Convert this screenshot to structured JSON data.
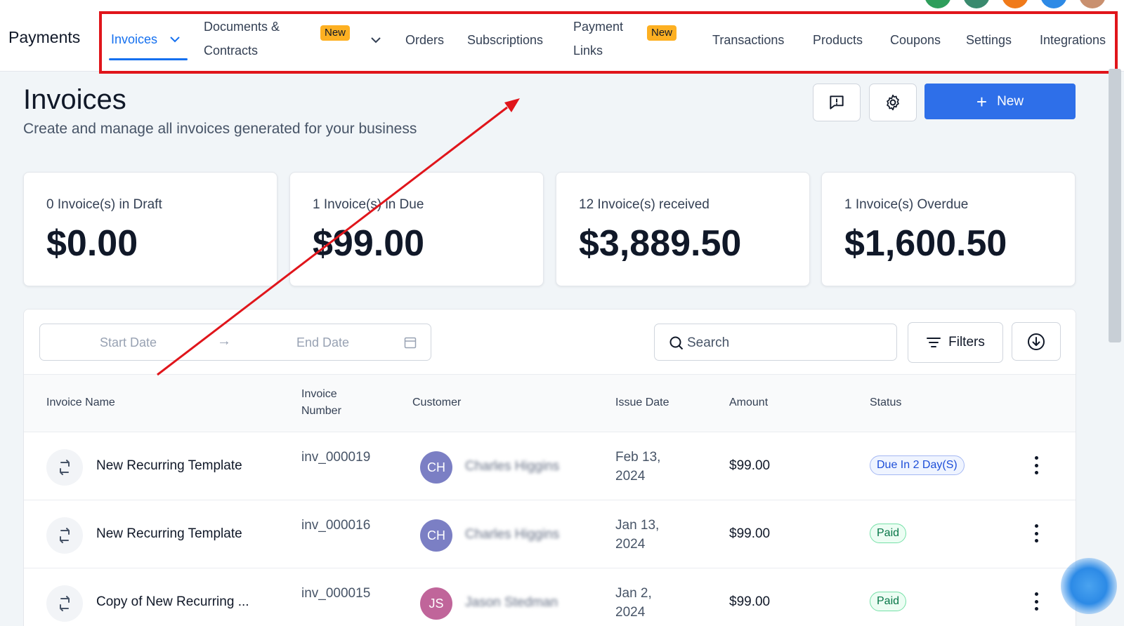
{
  "app": {
    "title": "Payments"
  },
  "nav": {
    "items": [
      {
        "label": "Invoices"
      },
      {
        "label_line1": "Documents &",
        "label_line2": "Contracts",
        "badge": "New"
      },
      {
        "label": "Orders"
      },
      {
        "label": "Subscriptions"
      },
      {
        "label_line1": "Payment",
        "label_line2": "Links",
        "badge": "New"
      },
      {
        "label": "Transactions"
      },
      {
        "label": "Products"
      },
      {
        "label": "Coupons"
      },
      {
        "label": "Settings"
      },
      {
        "label": "Integrations"
      }
    ]
  },
  "header": {
    "title": "Invoices",
    "subtitle": "Create and manage all invoices generated for your business",
    "new_button": "New",
    "plus": "+"
  },
  "stats": [
    {
      "label": "0 Invoice(s) in Draft",
      "value": "$0.00"
    },
    {
      "label": "1 Invoice(s) in Due",
      "value": "$99.00"
    },
    {
      "label": "12 Invoice(s) received",
      "value": "$3,889.50"
    },
    {
      "label": "1 Invoice(s) Overdue",
      "value": "$1,600.50"
    }
  ],
  "filters": {
    "start_placeholder": "Start Date",
    "end_placeholder": "End Date",
    "arrow": "→",
    "search_placeholder": "Search",
    "filters_label": "Filters"
  },
  "table": {
    "headers": {
      "name": "Invoice Name",
      "number_line1": "Invoice",
      "number_line2": "Number",
      "customer": "Customer",
      "issue_date": "Issue Date",
      "amount": "Amount",
      "status": "Status"
    },
    "rows": [
      {
        "name": "New Recurring Template",
        "number": "inv_000019",
        "initials": "CH",
        "avatar_color": "#7b7fc4",
        "customer": "Charles Higgins",
        "date": "Feb 13, 2024",
        "amount": "$99.00",
        "status": "Due In 2 Day(S)",
        "status_type": "due"
      },
      {
        "name": "New Recurring Template",
        "number": "inv_000016",
        "initials": "CH",
        "avatar_color": "#7b7fc4",
        "customer": "Charles Higgins",
        "date": "Jan 13, 2024",
        "amount": "$99.00",
        "status": "Paid",
        "status_type": "paid"
      },
      {
        "name": "Copy of New Recurring ...",
        "number": "inv_000015",
        "initials": "JS",
        "avatar_color": "#c0659a",
        "customer": "Jason Stedman",
        "date": "Jan 2, 2024",
        "amount": "$99.00",
        "status": "Paid",
        "status_type": "paid"
      }
    ]
  },
  "colors": {
    "accent": "#1570ef",
    "primary_button": "#2e6fe9",
    "badge_new": "#fdb022",
    "annotation_red": "#e0151b"
  },
  "icons": [
    "chevron-down-icon",
    "feedback-icon",
    "gear-icon",
    "plus-icon",
    "calendar-icon",
    "search-icon",
    "filter-icon",
    "download-icon",
    "recurring-icon",
    "more-vertical-icon",
    "chat-bubble-icon"
  ]
}
